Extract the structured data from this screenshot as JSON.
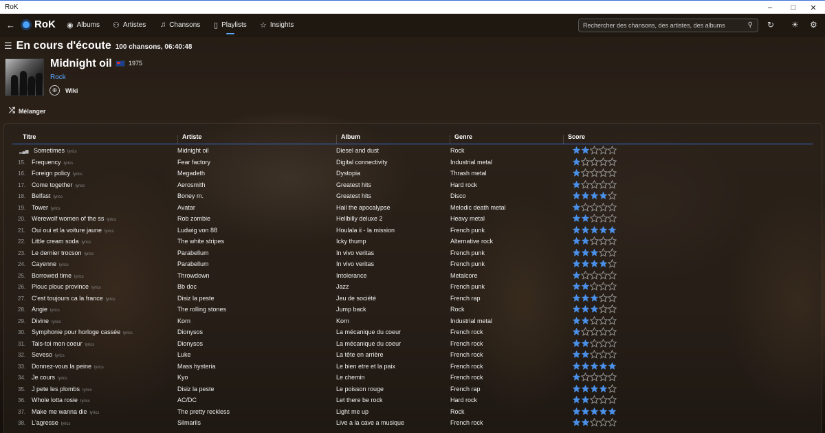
{
  "window": {
    "title": "RoK",
    "minimize": "–",
    "maximize": "□",
    "close": "✕"
  },
  "nav": {
    "back": "←",
    "logo": "RoK",
    "items": [
      {
        "label": "Albums",
        "icon": "disc-icon"
      },
      {
        "label": "Artistes",
        "icon": "people-icon"
      },
      {
        "label": "Chansons",
        "icon": "music-note-icon"
      },
      {
        "label": "Playlists",
        "icon": "playlist-icon"
      },
      {
        "label": "Insights",
        "icon": "star-icon"
      }
    ],
    "search_placeholder": "Rechercher des chansons, des artistes, des albums"
  },
  "header": {
    "title": "En cours d'écoute",
    "subtitle": "100 chansons, 06:40:48"
  },
  "artist": {
    "name": "Midnight oil",
    "year": "1975",
    "genre": "Rock",
    "wiki": "Wiki",
    "country_flag": "australia"
  },
  "shuffle_label": "Mélanger",
  "table": {
    "headers": {
      "title": "Titre",
      "artist": "Artiste",
      "album": "Album",
      "genre": "Genre",
      "score": "Score"
    },
    "lyrics_tag": "lyrics",
    "rows": [
      {
        "num": "",
        "playing": true,
        "title": "Sometimes",
        "artist": "Midnight oil",
        "album": "Diesel and dust",
        "genre": "Rock",
        "score": 2
      },
      {
        "num": "15.",
        "title": "Frequency",
        "artist": "Fear factory",
        "album": "Digital connectivity",
        "genre": "Industrial metal",
        "score": 1
      },
      {
        "num": "16.",
        "title": "Foreign policy",
        "artist": "Megadeth",
        "album": "Dystopia",
        "genre": "Thrash metal",
        "score": 1
      },
      {
        "num": "17.",
        "title": "Come together",
        "artist": "Aerosmith",
        "album": "Greatest hits",
        "genre": "Hard rock",
        "score": 1
      },
      {
        "num": "18.",
        "title": "Belfast",
        "artist": "Boney m.",
        "album": "Greatest hits",
        "genre": "Disco",
        "score": 4
      },
      {
        "num": "19.",
        "title": "Tower",
        "artist": "Avatar",
        "album": "Hail the apocalypse",
        "genre": "Melodic death metal",
        "score": 1
      },
      {
        "num": "20.",
        "title": "Werewolf women of the ss",
        "artist": "Rob zombie",
        "album": "Hellbilly deluxe 2",
        "genre": "Heavy metal",
        "score": 2
      },
      {
        "num": "21.",
        "title": "Oui oui et la voiture jaune",
        "artist": "Ludwig von 88",
        "album": "Houlala ii - la mission",
        "genre": "French punk",
        "score": 5
      },
      {
        "num": "22.",
        "title": "Little cream soda",
        "artist": "The white stripes",
        "album": "Icky thump",
        "genre": "Alternative rock",
        "score": 2
      },
      {
        "num": "23.",
        "title": "Le dernier trocson",
        "artist": "Parabellum",
        "album": "In vivo veritas",
        "genre": "French punk",
        "score": 3
      },
      {
        "num": "24.",
        "title": "Cayenne",
        "artist": "Parabellum",
        "album": "In vivo veritas",
        "genre": "French punk",
        "score": 4
      },
      {
        "num": "25.",
        "title": "Borrowed time",
        "artist": "Throwdown",
        "album": "Intolerance",
        "genre": "Metalcore",
        "score": 1
      },
      {
        "num": "26.",
        "title": "Plouc plouc province",
        "artist": "Bb doc",
        "album": "Jazz",
        "genre": "French punk",
        "score": 2
      },
      {
        "num": "27.",
        "title": "C'est toujours ca la france",
        "artist": "Disiz la peste",
        "album": "Jeu de société",
        "genre": "French rap",
        "score": 3
      },
      {
        "num": "28.",
        "title": "Angie",
        "artist": "The rolling stones",
        "album": "Jump back",
        "genre": "Rock",
        "score": 3
      },
      {
        "num": "29.",
        "title": "Divine",
        "artist": "Korn",
        "album": "Korn",
        "genre": "Industrial metal",
        "score": 2
      },
      {
        "num": "30.",
        "title": "Symphonie pour horloge cassée",
        "artist": "Dionysos",
        "album": "La mécanique du coeur",
        "genre": "French rock",
        "score": 1
      },
      {
        "num": "31.",
        "title": "Tais-toi mon coeur",
        "artist": "Dionysos",
        "album": "La mécanique du coeur",
        "genre": "French rock",
        "score": 2
      },
      {
        "num": "32.",
        "title": "Seveso",
        "artist": "Luke",
        "album": "La tête en arrière",
        "genre": "French rock",
        "score": 2
      },
      {
        "num": "33.",
        "title": "Donnez-vous la peine",
        "artist": "Mass hysteria",
        "album": "Le bien etre et la paix",
        "genre": "French rock",
        "score": 5
      },
      {
        "num": "34.",
        "title": "Je cours",
        "artist": "Kyo",
        "album": "Le chemin",
        "genre": "French rock",
        "score": 1
      },
      {
        "num": "35.",
        "title": "J pete les plombs",
        "artist": "Disiz la peste",
        "album": "Le poisson rouge",
        "genre": "French rap",
        "score": 4
      },
      {
        "num": "36.",
        "title": "Whole lotta rosie",
        "artist": "AC/DC",
        "album": "Let there be rock",
        "genre": "Hard rock",
        "score": 2
      },
      {
        "num": "37.",
        "title": "Make me wanna die",
        "artist": "The pretty reckless",
        "album": "Light me up",
        "genre": "Rock",
        "score": 5
      },
      {
        "num": "38.",
        "title": "L'agresse",
        "artist": "Silmarils",
        "album": "Live a la cave a musique",
        "genre": "French rock",
        "score": 2
      }
    ]
  },
  "colors": {
    "accent": "#5aa8ff",
    "star_filled": "#4a8fe8",
    "star_empty": "#9a9a9a"
  }
}
